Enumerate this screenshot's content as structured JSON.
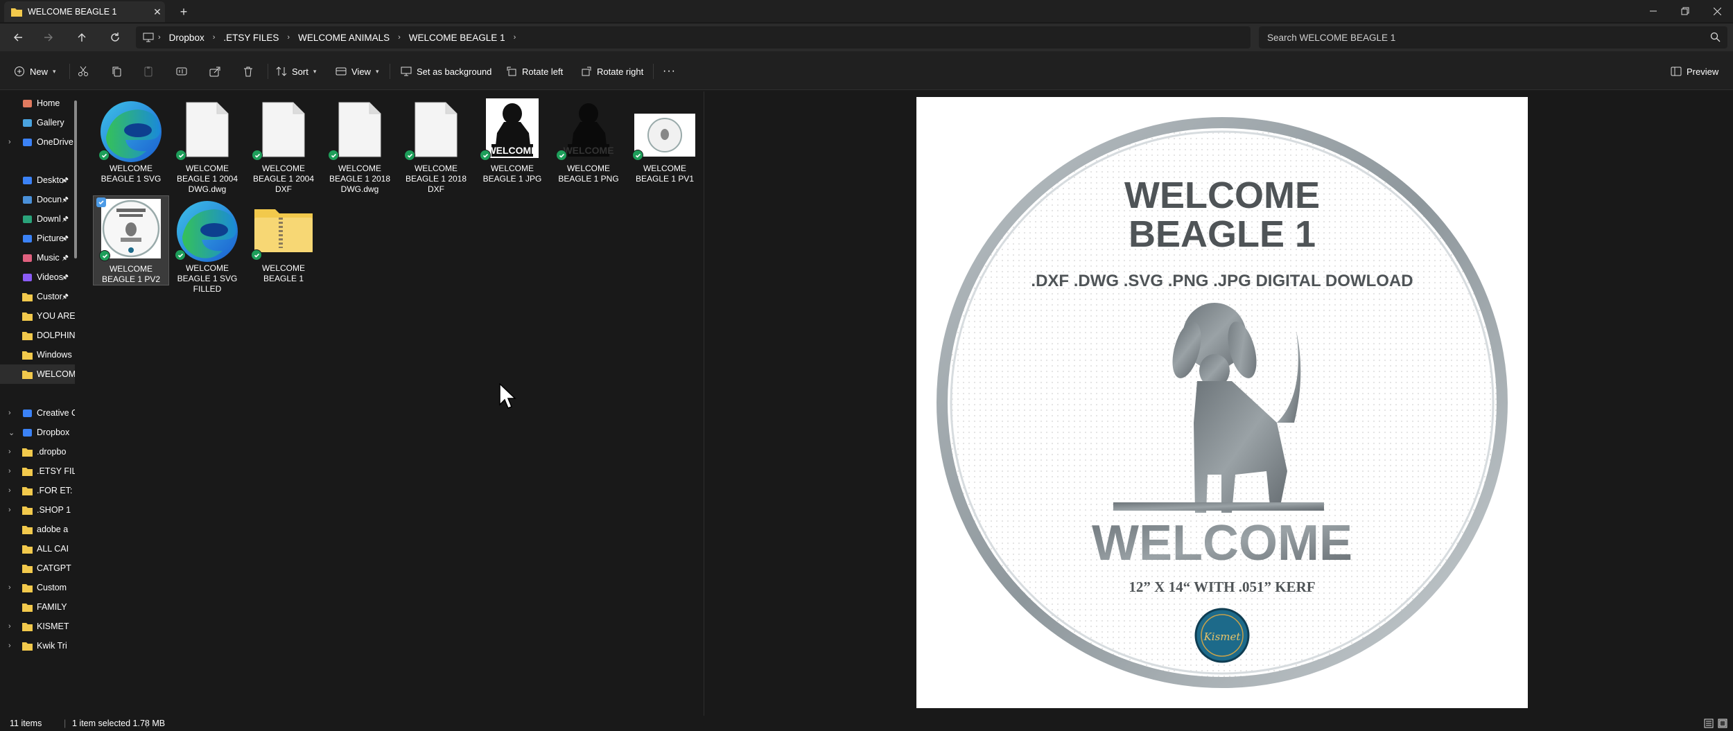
{
  "window": {
    "tab_title": "WELCOME BEAGLE 1",
    "new_tab": "+",
    "close_tab": "✕"
  },
  "breadcrumb": [
    "Dropbox",
    ".ETSY FILES",
    "WELCOME ANIMALS",
    "WELCOME BEAGLE 1"
  ],
  "search": {
    "placeholder": "Search WELCOME BEAGLE 1"
  },
  "toolbar": {
    "new_label": "New",
    "sort_label": "Sort",
    "view_label": "View",
    "set_background_label": "Set as background",
    "rotate_left_label": "Rotate left",
    "rotate_right_label": "Rotate right",
    "preview_label": "Preview",
    "more_label": "···"
  },
  "sidebar": {
    "items": [
      {
        "label": "Home",
        "icon": "home-icon"
      },
      {
        "label": "Gallery",
        "icon": "gallery-icon"
      },
      {
        "label": "OneDrive",
        "icon": "cloud-icon"
      },
      {
        "label": "Deskto",
        "icon": "desktop-icon"
      },
      {
        "label": "Docun",
        "icon": "documents-icon"
      },
      {
        "label": "Downl",
        "icon": "downloads-icon"
      },
      {
        "label": "Picture",
        "icon": "pictures-icon"
      },
      {
        "label": "Music",
        "icon": "music-icon"
      },
      {
        "label": "Videos",
        "icon": "videos-icon"
      },
      {
        "label": "Custor",
        "icon": "folder-icon"
      },
      {
        "label": "YOU ARE",
        "icon": "folder-icon"
      },
      {
        "label": "DOLPHIN",
        "icon": "folder-icon"
      },
      {
        "label": "Windows",
        "icon": "folder-icon"
      },
      {
        "label": "WELCOM",
        "icon": "folder-icon"
      },
      {
        "label": "Creative C",
        "icon": "cloud-icon"
      },
      {
        "label": "Dropbox",
        "icon": "dropbox-icon"
      },
      {
        "label": ".dropbo",
        "icon": "folder-icon"
      },
      {
        "label": ".ETSY FIL",
        "icon": "folder-icon"
      },
      {
        "label": ".FOR ET:",
        "icon": "folder-icon"
      },
      {
        "label": ".SHOP 1",
        "icon": "folder-icon"
      },
      {
        "label": "adobe a",
        "icon": "folder-icon"
      },
      {
        "label": "ALL CAI",
        "icon": "folder-icon"
      },
      {
        "label": "CATGPT",
        "icon": "folder-icon"
      },
      {
        "label": "Custom",
        "icon": "folder-icon"
      },
      {
        "label": "FAMILY",
        "icon": "folder-icon"
      },
      {
        "label": "KISMET",
        "icon": "folder-icon"
      },
      {
        "label": "Kwik Tri",
        "icon": "folder-icon"
      }
    ]
  },
  "files": [
    {
      "line1": "WELCOME",
      "line2": "BEAGLE 1  SVG",
      "line3": "",
      "kind": "edge-icon"
    },
    {
      "line1": "WELCOME",
      "line2": "BEAGLE 1 2004",
      "line3": "DWG.dwg",
      "kind": "document-icon"
    },
    {
      "line1": "WELCOME",
      "line2": "BEAGLE 1 2004",
      "line3": "DXF",
      "kind": "document-icon"
    },
    {
      "line1": "WELCOME",
      "line2": "BEAGLE 1 2018",
      "line3": "DWG.dwg",
      "kind": "document-icon"
    },
    {
      "line1": "WELCOME",
      "line2": "BEAGLE 1 2018",
      "line3": "DXF",
      "kind": "document-icon"
    },
    {
      "line1": "WELCOME",
      "line2": "BEAGLE 1 JPG",
      "line3": "",
      "kind": "image-thumbnail"
    },
    {
      "line1": "WELCOME",
      "line2": "BEAGLE 1 PNG",
      "line3": "",
      "kind": "image-thumbnail"
    },
    {
      "line1": "WELCOME",
      "line2": "BEAGLE 1 PV1",
      "line3": "",
      "kind": "image-thumbnail"
    },
    {
      "line1": "WELCOME",
      "line2": "BEAGLE 1 PV2",
      "line3": "",
      "kind": "image-thumbnail"
    },
    {
      "line1": "WELCOME",
      "line2": "BEAGLE 1 SVG",
      "line3": "FILLED",
      "kind": "edge-icon"
    },
    {
      "line1": "WELCOME",
      "line2": "BEAGLE 1",
      "line3": "",
      "kind": "zip-folder-icon"
    }
  ],
  "thumbs": {
    "jpg_text": "WELCOME",
    "png_text": "WELCOME"
  },
  "preview": {
    "title1": "WELCOME",
    "title2": "BEAGLE 1",
    "formats": ".DXF .DWG .SVG .PNG .JPG DIGITAL DOWLOAD",
    "word": "WELCOME",
    "size": "12” X 14“ WITH .051” KERF",
    "logo": "Kismet"
  },
  "status": {
    "count": "11 items",
    "selection": "1 item selected  1.78 MB"
  }
}
